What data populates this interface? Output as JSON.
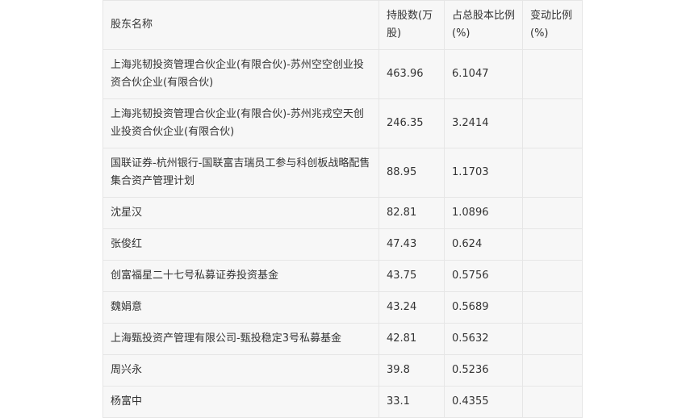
{
  "table": {
    "headers": [
      "股东名称",
      "持股数(万股)",
      "占总股本比例(%)",
      "变动比例(%)"
    ],
    "rows": [
      {
        "name": "上海兆韧投资管理合伙企业(有限合伙)-苏州空空创业投资合伙企业(有限合伙)",
        "shares": "463.96",
        "ratio": "6.1047",
        "change": ""
      },
      {
        "name": "上海兆韧投资管理合伙企业(有限合伙)-苏州兆戎空天创业投资合伙企业(有限合伙)",
        "shares": "246.35",
        "ratio": "3.2414",
        "change": ""
      },
      {
        "name": "国联证券-杭州银行-国联富吉瑞员工参与科创板战略配售集合资产管理计划",
        "shares": "88.95",
        "ratio": "1.1703",
        "change": ""
      },
      {
        "name": "沈星汉",
        "shares": "82.81",
        "ratio": "1.0896",
        "change": ""
      },
      {
        "name": "张俊红",
        "shares": "47.43",
        "ratio": "0.624",
        "change": ""
      },
      {
        "name": "创富福星二十七号私募证券投资基金",
        "shares": "43.75",
        "ratio": "0.5756",
        "change": ""
      },
      {
        "name": "魏娟意",
        "shares": "43.24",
        "ratio": "0.5689",
        "change": ""
      },
      {
        "name": "上海甄投资产管理有限公司-甄投稳定3号私募基金",
        "shares": "42.81",
        "ratio": "0.5632",
        "change": ""
      },
      {
        "name": "周兴永",
        "shares": "39.8",
        "ratio": "0.5236",
        "change": ""
      },
      {
        "name": "杨富中",
        "shares": "33.1",
        "ratio": "0.4355",
        "change": ""
      }
    ]
  }
}
